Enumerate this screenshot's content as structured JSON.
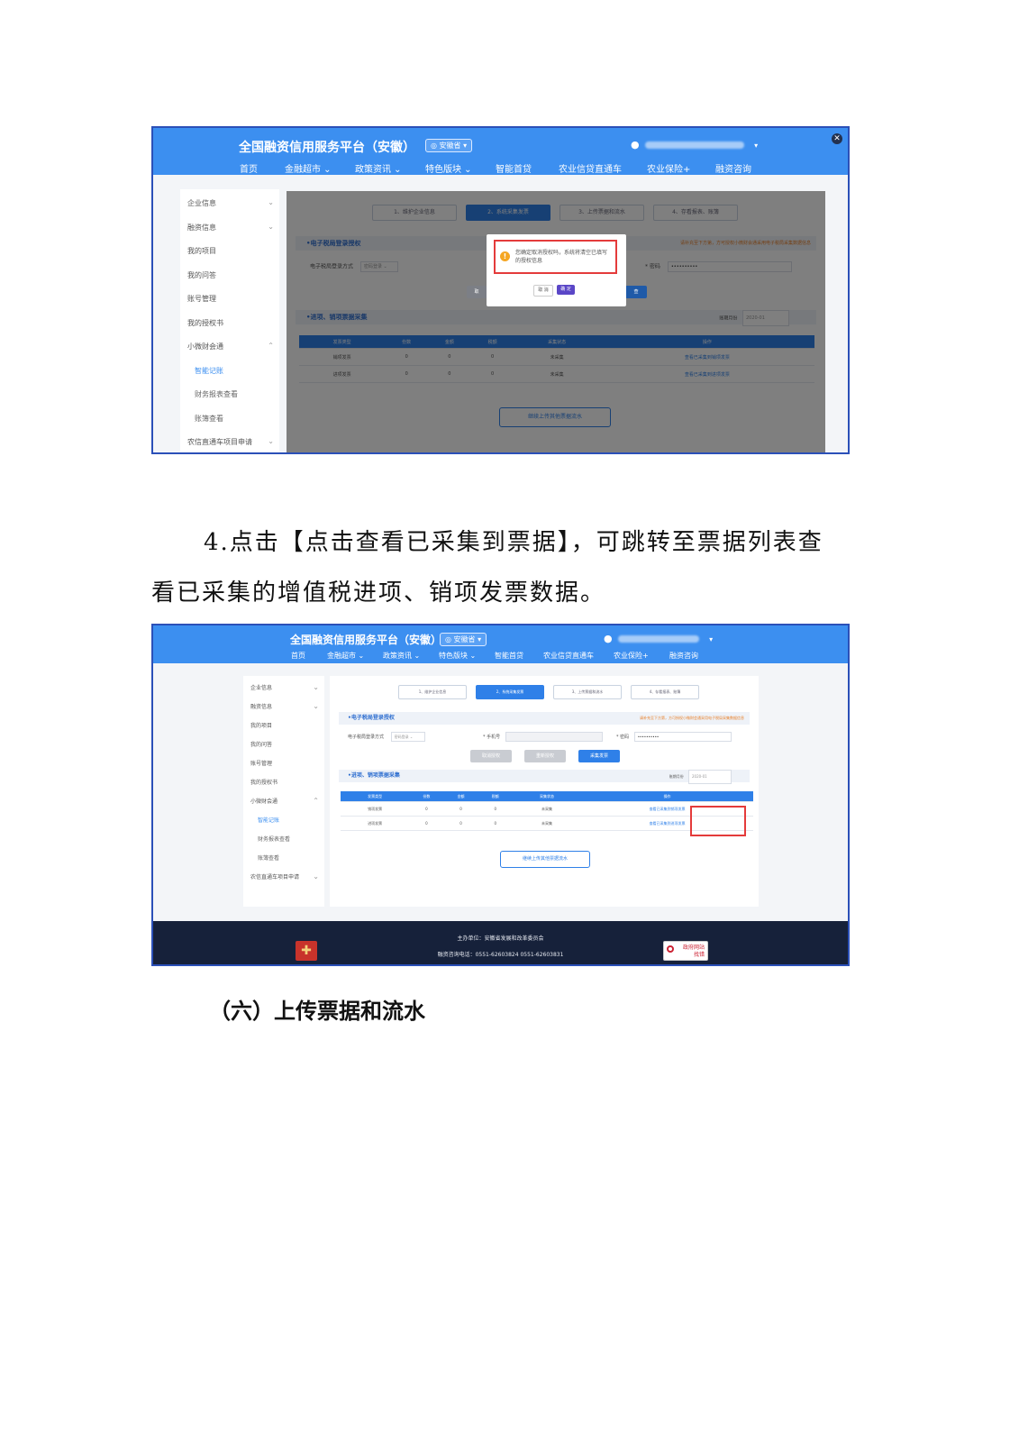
{
  "screenshot1": {
    "platform_title": "全国融资信用服务平台（安徽）",
    "region": "◎ 安徽省 ▾",
    "user_caret": "▾",
    "nav": [
      "首页",
      "金融超市 ⌄",
      "政策资讯 ⌄",
      "特色版块 ⌄",
      "智能首贷",
      "农业信贷直通车",
      "农业保险+",
      "融资咨询"
    ],
    "close": "✕",
    "sidebar": [
      {
        "label": "企业信息",
        "chev": "⌄"
      },
      {
        "label": "融资信息",
        "chev": "⌄"
      },
      {
        "label": "我的项目",
        "chev": ""
      },
      {
        "label": "我的问答",
        "chev": ""
      },
      {
        "label": "账号管理",
        "chev": ""
      },
      {
        "label": "我的授权书",
        "chev": ""
      },
      {
        "label": "小微财会通",
        "chev": "⌃"
      },
      {
        "label": "智能记账",
        "chev": "",
        "sub": true,
        "active": true
      },
      {
        "label": "财务报表查看",
        "chev": "",
        "sub": true
      },
      {
        "label": "账簿查看",
        "chev": "",
        "sub": true
      },
      {
        "label": "农信直通车项目申请",
        "chev": "⌄"
      }
    ],
    "steps": [
      "1、维护企业信息",
      "2、系统采集发票",
      "3、上传票据和流水",
      "4、存看报表、账簿"
    ],
    "section_login": "•电子税局登录授权",
    "section_login_note": "请补充至下方第，方可授权小微财会通采用电子税局采集数据信息",
    "login_method_label": "电子税局登录方式",
    "login_method_value": "密码登录 ⌄",
    "pwd_label": "* 密码",
    "pwd_value": "••••••••••",
    "section_collect": "•进项、销项票据采集",
    "period_label": "账期月份",
    "period_value": "2020-01",
    "table_headers": [
      "发票类型",
      "份数",
      "金额",
      "税额",
      "采集状态",
      "操作"
    ],
    "table_rows": [
      [
        "销项发票",
        "0",
        "0",
        "0",
        "未采集",
        "查看已采集到销项发票"
      ],
      [
        "进项发票",
        "0",
        "0",
        "0",
        "未采集",
        "查看已采集到进项发票"
      ]
    ],
    "upload_btn": "继续上传其他票据流水",
    "dialog_msg": "您确定取消授权吗，系统将清空已填写的授权信息",
    "dialog_cancel": "取 消",
    "dialog_ok": "确 定",
    "hidden_btn_left": "取",
    "hidden_btn_right": "查"
  },
  "paragraph": {
    "line1": "4.点击【点击查看已采集到票据】，可跳转至票据列表查",
    "line2": "看已采集的增值税进项、销项发票数据。"
  },
  "screenshot2": {
    "platform_title": "全国融资信用服务平台（安徽）",
    "region": "◎ 安徽省 ▾",
    "user_caret": "▾",
    "nav": [
      "首页",
      "金融超市 ⌄",
      "政策资讯 ⌄",
      "特色版块 ⌄",
      "智能首贷",
      "农业信贷直通车",
      "农业保险+",
      "融资咨询"
    ],
    "sidebar": [
      {
        "label": "企业信息",
        "chev": "⌄"
      },
      {
        "label": "融资信息",
        "chev": "⌄"
      },
      {
        "label": "我的项目",
        "chev": ""
      },
      {
        "label": "我的问答",
        "chev": ""
      },
      {
        "label": "账号管理",
        "chev": ""
      },
      {
        "label": "我的授权书",
        "chev": ""
      },
      {
        "label": "小微财会通",
        "chev": "⌃"
      },
      {
        "label": "智能记账",
        "chev": "",
        "sub": true,
        "active": true
      },
      {
        "label": "财务报表查看",
        "chev": "",
        "sub": true
      },
      {
        "label": "账簿查看",
        "chev": "",
        "sub": true
      },
      {
        "label": "农信直通车项目申请",
        "chev": "⌄"
      }
    ],
    "steps": [
      "1、维护企业信息",
      "2、系统采集发票",
      "3、上传票据和流水",
      "4、存看报表、账簿"
    ],
    "section_login": "•电子税局登录授权",
    "section_login_note": "请补充至下方第，方可授权小微财会通采用电子税局采集数据信息",
    "login_method_label": "电子税局登录方式",
    "login_method_value": "密码登录 ⌄",
    "phone_label": "* 手机号",
    "pwd_label": "* 密码",
    "pwd_value": "••••••••••",
    "btn_cancel_auth": "取消授权",
    "btn_re_auth": "重新授权",
    "btn_collect": "采集发票",
    "section_collect": "•进项、销项票据采集",
    "period_label": "账期月份",
    "period_value": "2020-01",
    "table_headers": [
      "发票类型",
      "份数",
      "金额",
      "税额",
      "采集状态",
      "操作"
    ],
    "table_rows": [
      [
        "销项发票",
        "0",
        "0",
        "0",
        "未采集",
        "查看已采集到销项发票"
      ],
      [
        "进项发票",
        "0",
        "0",
        "0",
        "未采集",
        "查看已采集到进项发票"
      ]
    ],
    "upload_btn": "继续上传其他票据流水",
    "footer_sponsor": "主办单位：安徽省发展和改革委员会",
    "footer_phone": "融资咨询电话：0551-62603824      0551-62603831",
    "gov_logo_line1": "政府网站",
    "gov_logo_line2": "找错"
  },
  "heading": "（六）上传票据和流水"
}
